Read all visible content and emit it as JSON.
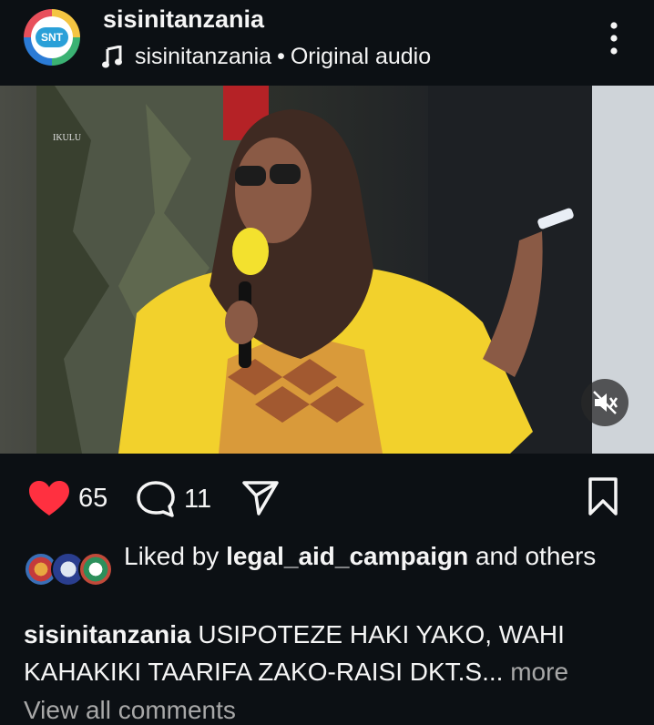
{
  "post": {
    "username": "sisinitanzania",
    "avatar_text": "SNT",
    "audio_user": "sisinitanzania",
    "audio_separator": "•",
    "audio_label": "Original audio"
  },
  "video": {
    "watermark": "IKULU",
    "muted": true
  },
  "actions": {
    "likes": "65",
    "comments": "11"
  },
  "liked_by": {
    "prefix": "Liked by",
    "user": "legal_aid_campaign",
    "suffix": "and others"
  },
  "caption": {
    "username": "sisinitanzania",
    "text": "USIPOTEZE HAKI YAKO, WAHI KAHAKIKI TAARIFA ZAKO-RAISI DKT.S...",
    "more_label": "more"
  },
  "view_all_comments": "View all comments",
  "colors": {
    "background": "#0c1014",
    "heart": "#ff3040",
    "muted_text": "#a8a8a8"
  }
}
